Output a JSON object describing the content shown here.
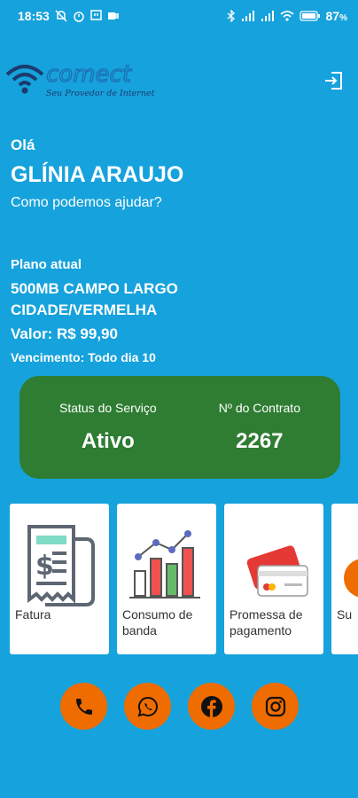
{
  "status_bar": {
    "time": "18:53",
    "battery": "87",
    "battery_unit": "%"
  },
  "brand": {
    "name": "comect",
    "tagline": "Seu Provedor de Internet"
  },
  "greeting": {
    "hello": "Olá",
    "name": "GLÍNIA ARAUJO",
    "help": "Como podemos ajudar?"
  },
  "plan": {
    "label": "Plano atual",
    "name": "500MB CAMPO LARGO CIDADE/VERMELHA",
    "price": "Valor: R$ 99,90",
    "due": "Vencimento: Todo dia 10"
  },
  "service": {
    "status_label": "Status do Serviço",
    "status_value": "Ativo",
    "contract_label": "Nº do Contrato",
    "contract_value": "2267"
  },
  "menu": [
    {
      "label": "Fatura",
      "icon": "invoice-icon"
    },
    {
      "label": "Consumo de banda",
      "icon": "bar-chart-icon"
    },
    {
      "label": "Promessa de pagamento",
      "icon": "credit-card-icon"
    },
    {
      "label": "Su",
      "icon": "support-icon"
    }
  ],
  "social": [
    "phone-icon",
    "whatsapp-icon",
    "facebook-icon",
    "instagram-icon"
  ],
  "colors": {
    "background": "#16a2dc",
    "status_card": "#2e7d32",
    "social_button": "#ef6c00"
  }
}
